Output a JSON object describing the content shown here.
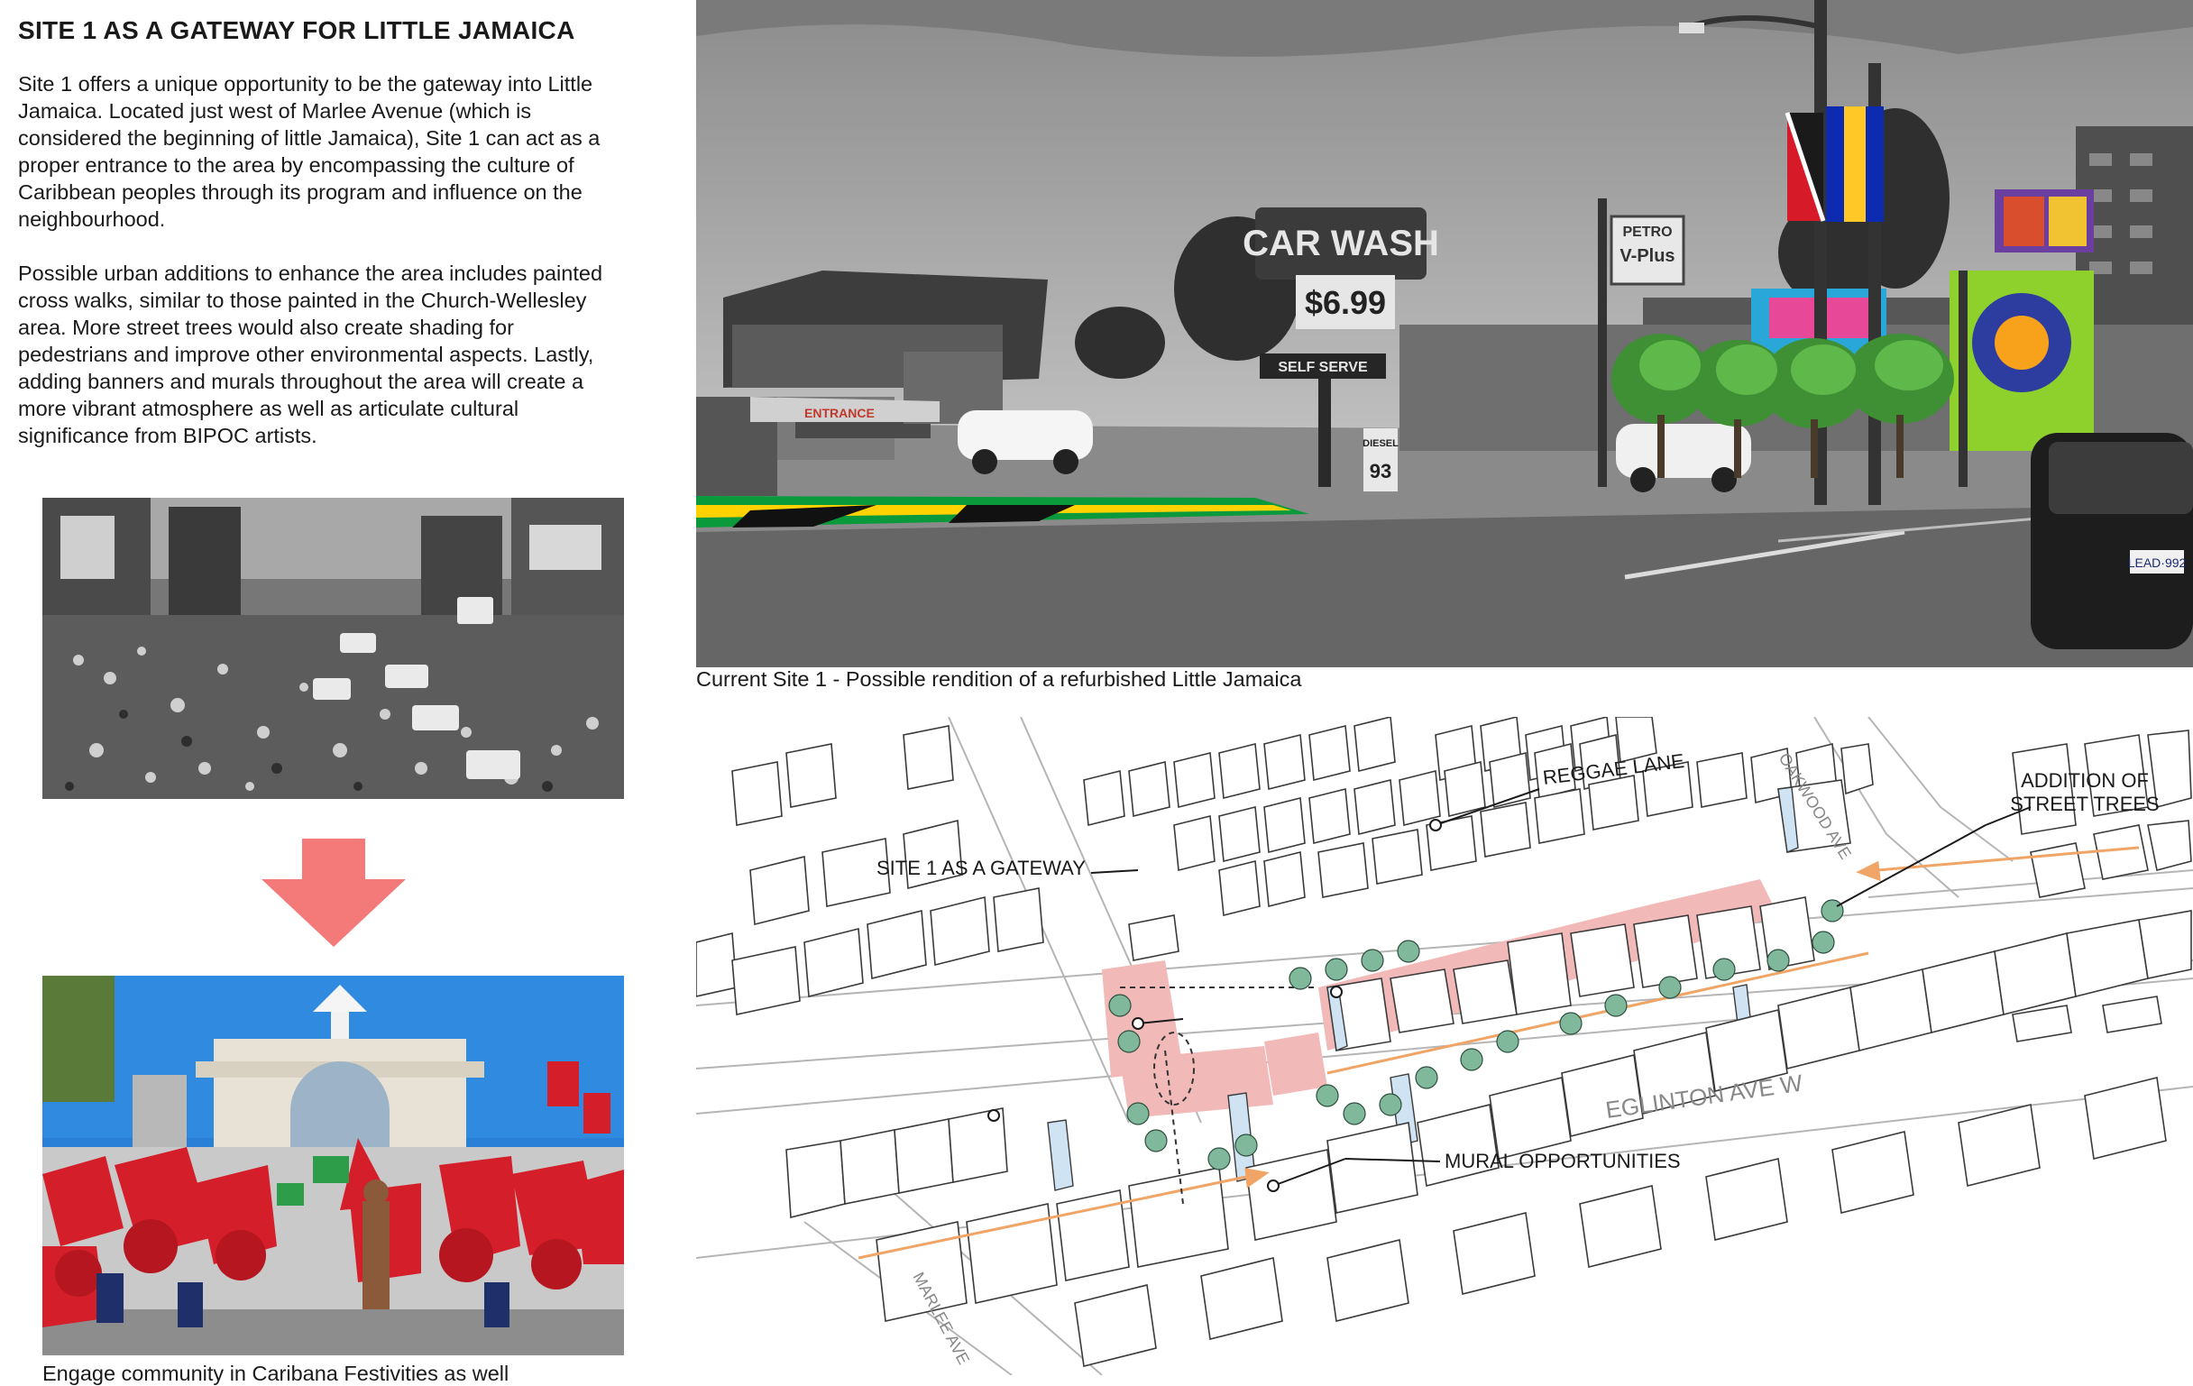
{
  "title": "SITE 1 AS A GATEWAY FOR LITTLE JAMAICA",
  "paragraphs": [
    "Site 1 offers a unique opportunity to be the gateway into Little Jamaica. Located just west of Marlee Avenue (which is considered the beginning of little Jamaica), Site 1 can act as a proper entrance to the area by encompassing the culture of Caribbean peoples through its program and influence on the neighbourhood.",
    "Possible urban additions to enhance the area includes painted cross walks, similar to those painted in the Church-Wellesley area. More street trees would also create shading for pedestrians and improve other environmental aspects. Lastly, adding banners and murals throughout the area will create a more vibrant atmosphere as well as articulate cultural significance from BIPOC artists."
  ],
  "captions": {
    "carnival": "Engage community in Caribana Festivities as well",
    "street": "Current Site 1 - Possible rendition of a refurbished Little Jamaica"
  },
  "street_photo": {
    "signs": {
      "car_wash": "CAR WASH",
      "price": "$6.99",
      "self_serve": "SELF SERVE",
      "entrance": "ENTRANCE",
      "petro": "PETRO",
      "vplus": "V-Plus",
      "diesel": "DIESEL",
      "diesel_price": "93",
      "plate": "LEAD·992"
    }
  },
  "map": {
    "labels": {
      "reggae_lane": "REGGAE LANE",
      "addition_line1": "ADDITION OF",
      "addition_line2": "STREET TREES",
      "site_gateway": "SITE 1 AS A GATEWAY",
      "eglinton": "EGLINTON AVE W",
      "mural": "MURAL OPPORTUNITIES",
      "oakwood": "OAKWOOD AVE",
      "marlee": "MARLEE AVE"
    }
  },
  "colors": {
    "arrow": "#f47a7a",
    "highlight": "#f2b9b9",
    "mural_face": "#cfe3f3",
    "tree": "#7fb89a",
    "flow": "#f0a566",
    "jamaica_green": "#0a9a3c",
    "jamaica_yellow": "#ffd200"
  }
}
